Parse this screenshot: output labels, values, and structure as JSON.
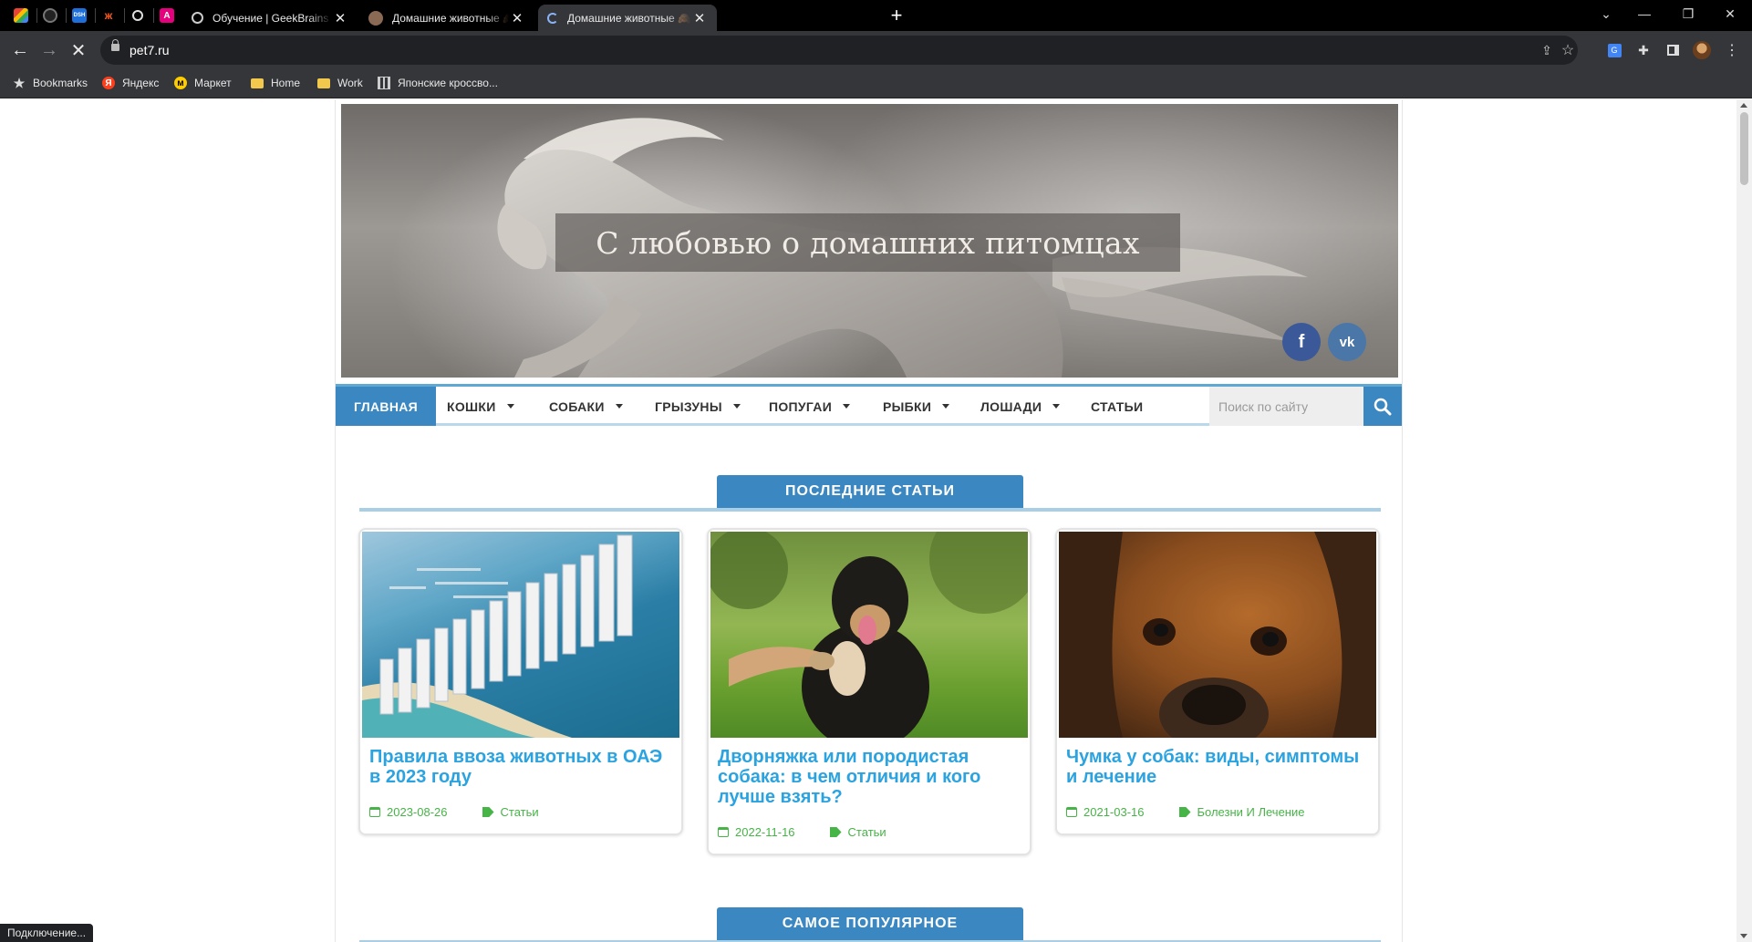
{
  "browser": {
    "tabs": [
      {
        "title": "Обучение | GeekBrains - образов",
        "active": false
      },
      {
        "title": "Домашние животные 🙈 Все п",
        "active": false
      },
      {
        "title": "Домашние животные 🙈 Все п",
        "active": true
      }
    ],
    "new_tab": "+",
    "url": "pet7.ru",
    "bookmarks": [
      {
        "label": "Bookmarks",
        "icon": "star-icon"
      },
      {
        "label": "Яндекс",
        "icon": "yandex-icon"
      },
      {
        "label": "Маркет",
        "icon": "market-icon"
      },
      {
        "label": "Home",
        "icon": "folder-icon"
      },
      {
        "label": "Work",
        "icon": "folder-icon"
      },
      {
        "label": "Японские кроссво...",
        "icon": "crossword-icon"
      }
    ],
    "status": "Подключение..."
  },
  "site": {
    "title": "С любовью о домашних питомцах",
    "social": [
      {
        "icon": "facebook-icon",
        "glyph": "f",
        "color": "#3b5998"
      },
      {
        "icon": "vk-icon",
        "glyph": "vk",
        "color": "#4a76a8"
      }
    ],
    "menu": [
      {
        "label": "ГЛАВНАЯ",
        "active": true,
        "dropdown": false
      },
      {
        "label": "КОШКИ",
        "active": false,
        "dropdown": true
      },
      {
        "label": "СОБАКИ",
        "active": false,
        "dropdown": true
      },
      {
        "label": "ГРЫЗУНЫ",
        "active": false,
        "dropdown": true
      },
      {
        "label": "ПОПУГАИ",
        "active": false,
        "dropdown": true
      },
      {
        "label": "РЫБКИ",
        "active": false,
        "dropdown": true
      },
      {
        "label": "ЛОШАДИ",
        "active": false,
        "dropdown": true
      },
      {
        "label": "СТАТЬИ",
        "active": false,
        "dropdown": false
      }
    ],
    "search_placeholder": "Поиск по сайту",
    "accent_color": "#3b87c1",
    "link_color": "#2aa3e0",
    "meta_color": "#46b446"
  },
  "sections": {
    "latest": "ПОСЛЕДНИЕ СТАТЬИ",
    "popular": "САМОЕ ПОПУЛЯРНОЕ"
  },
  "articles": [
    {
      "title": "Правила ввоза животных в ОАЭ в 2023 году",
      "date": "2023-08-26",
      "category": "Статьи",
      "image": "dubai-coast-photo"
    },
    {
      "title": "Дворняжка или породистая собака: в чем отличия и кого лучше взять?",
      "date": "2022-11-16",
      "category": "Статьи",
      "image": "black-dog-paw-photo"
    },
    {
      "title": "Чумка у собак: виды, симптомы и лечение",
      "date": "2021-03-16",
      "category": "Болезни И Лечение",
      "image": "beagle-photo"
    }
  ]
}
